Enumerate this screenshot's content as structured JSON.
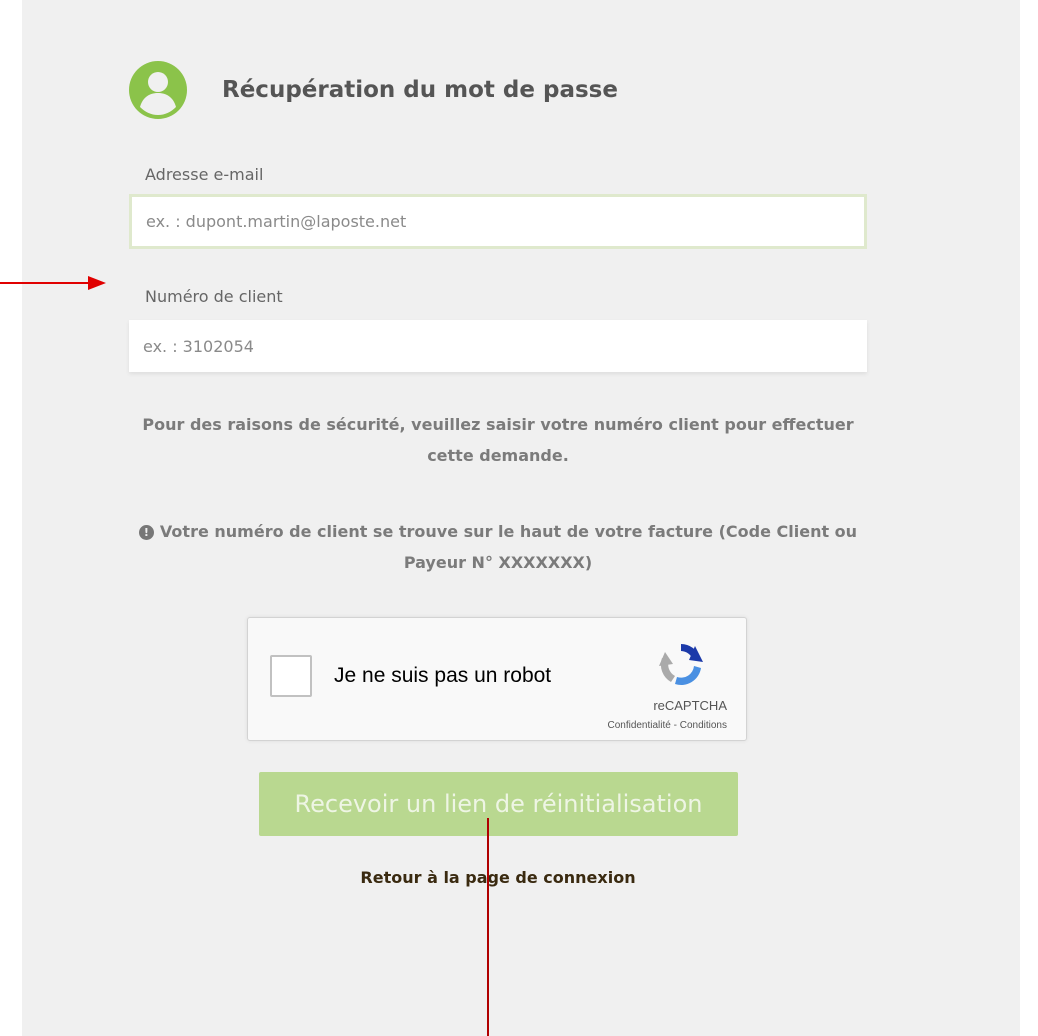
{
  "header": {
    "title": "Récupération du mot de passe",
    "icon": "user-avatar-icon"
  },
  "form": {
    "email": {
      "label": "Adresse e-mail",
      "placeholder": "ex. : dupont.martin@laposte.net",
      "value": ""
    },
    "client_number": {
      "label": "Numéro de client",
      "placeholder": "ex. : 3102054",
      "value": ""
    },
    "security_note": "Pour des raisons de sécurité, veuillez saisir votre numéro client pour effectuer cette demande.",
    "info_note": "Votre numéro de client se trouve sur le haut de votre facture (Code Client ou Payeur N° XXXXXXX)"
  },
  "recaptcha": {
    "label": "Je ne suis pas un robot",
    "brand": "reCAPTCHA",
    "privacy": "Confidentialité",
    "separator": " - ",
    "terms": "Conditions",
    "checked": false
  },
  "actions": {
    "submit_label": "Recevoir un lien de réinitialisation",
    "back_label": "Retour à la page de connexion"
  },
  "colors": {
    "accent_green": "#8bc34a",
    "button_green": "#b9d890",
    "annotation_red": "#e00000",
    "panel_background": "#f0f0f0"
  }
}
